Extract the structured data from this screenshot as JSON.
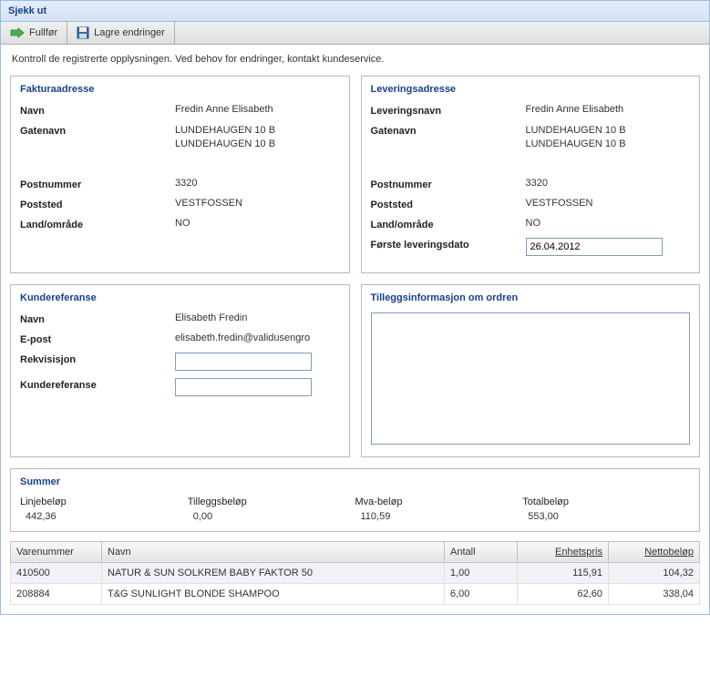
{
  "header": {
    "title": "Sjekk ut"
  },
  "toolbar": {
    "fullfor_label": "Fullfør",
    "lagre_label": "Lagre endringer"
  },
  "instruction": "Kontroll de registrerte opplysningen. Ved behov for endringer, kontakt kundeservice.",
  "faktura": {
    "title": "Fakturaadresse",
    "navn_label": "Navn",
    "navn_val": "Fredin Anne Elisabeth",
    "gate_label": "Gatenavn",
    "gate_val1": "LUNDEHAUGEN 10 B",
    "gate_val2": "LUNDEHAUGEN 10 B",
    "postnr_label": "Postnummer",
    "postnr_val": "3320",
    "poststed_label": "Poststed",
    "poststed_val": "VESTFOSSEN",
    "land_label": "Land/område",
    "land_val": "NO"
  },
  "levering": {
    "title": "Leveringsadresse",
    "navn_label": "Leveringsnavn",
    "navn_val": "Fredin Anne Elisabeth",
    "gate_label": "Gatenavn",
    "gate_val1": "LUNDEHAUGEN 10 B",
    "gate_val2": "LUNDEHAUGEN 10 B",
    "postnr_label": "Postnummer",
    "postnr_val": "3320",
    "poststed_label": "Poststed",
    "poststed_val": "VESTFOSSEN",
    "land_label": "Land/område",
    "land_val": "NO",
    "dato_label": "Første leveringsdato",
    "dato_val": "26.04.2012"
  },
  "kunderef": {
    "title": "Kundereferanse",
    "navn_label": "Navn",
    "navn_val": "Elisabeth Fredin",
    "epost_label": "E-post",
    "epost_val": "elisabeth.fredin@validusengro",
    "rekv_label": "Rekvisisjon",
    "rekv_val": "",
    "kref_label": "Kundereferanse",
    "kref_val": ""
  },
  "tillegg": {
    "title": "Tilleggsinformasjon om ordren",
    "value": ""
  },
  "summer": {
    "title": "Summer",
    "linje_label": "Linjebeløp",
    "linje_val": "442,36",
    "till_label": "Tilleggsbeløp",
    "till_val": "0,00",
    "mva_label": "Mva-beløp",
    "mva_val": "110,59",
    "total_label": "Totalbeløp",
    "total_val": "553,00"
  },
  "table": {
    "hdr_varenummer": "Varenummer",
    "hdr_navn": "Navn",
    "hdr_antall": "Antall",
    "hdr_enhetspris": "Enhetspris",
    "hdr_nettobelop": "Nettobeløp",
    "rows": [
      {
        "varenummer": "410500",
        "navn": "NATUR & SUN SOLKREM BABY FAKTOR 50",
        "antall": "1,00",
        "enhetspris": "115,91",
        "nettobelop": "104,32"
      },
      {
        "varenummer": "208884",
        "navn": "T&G SUNLIGHT BLONDE SHAMPOO",
        "antall": "6,00",
        "enhetspris": "62,60",
        "nettobelop": "338,04"
      }
    ]
  }
}
